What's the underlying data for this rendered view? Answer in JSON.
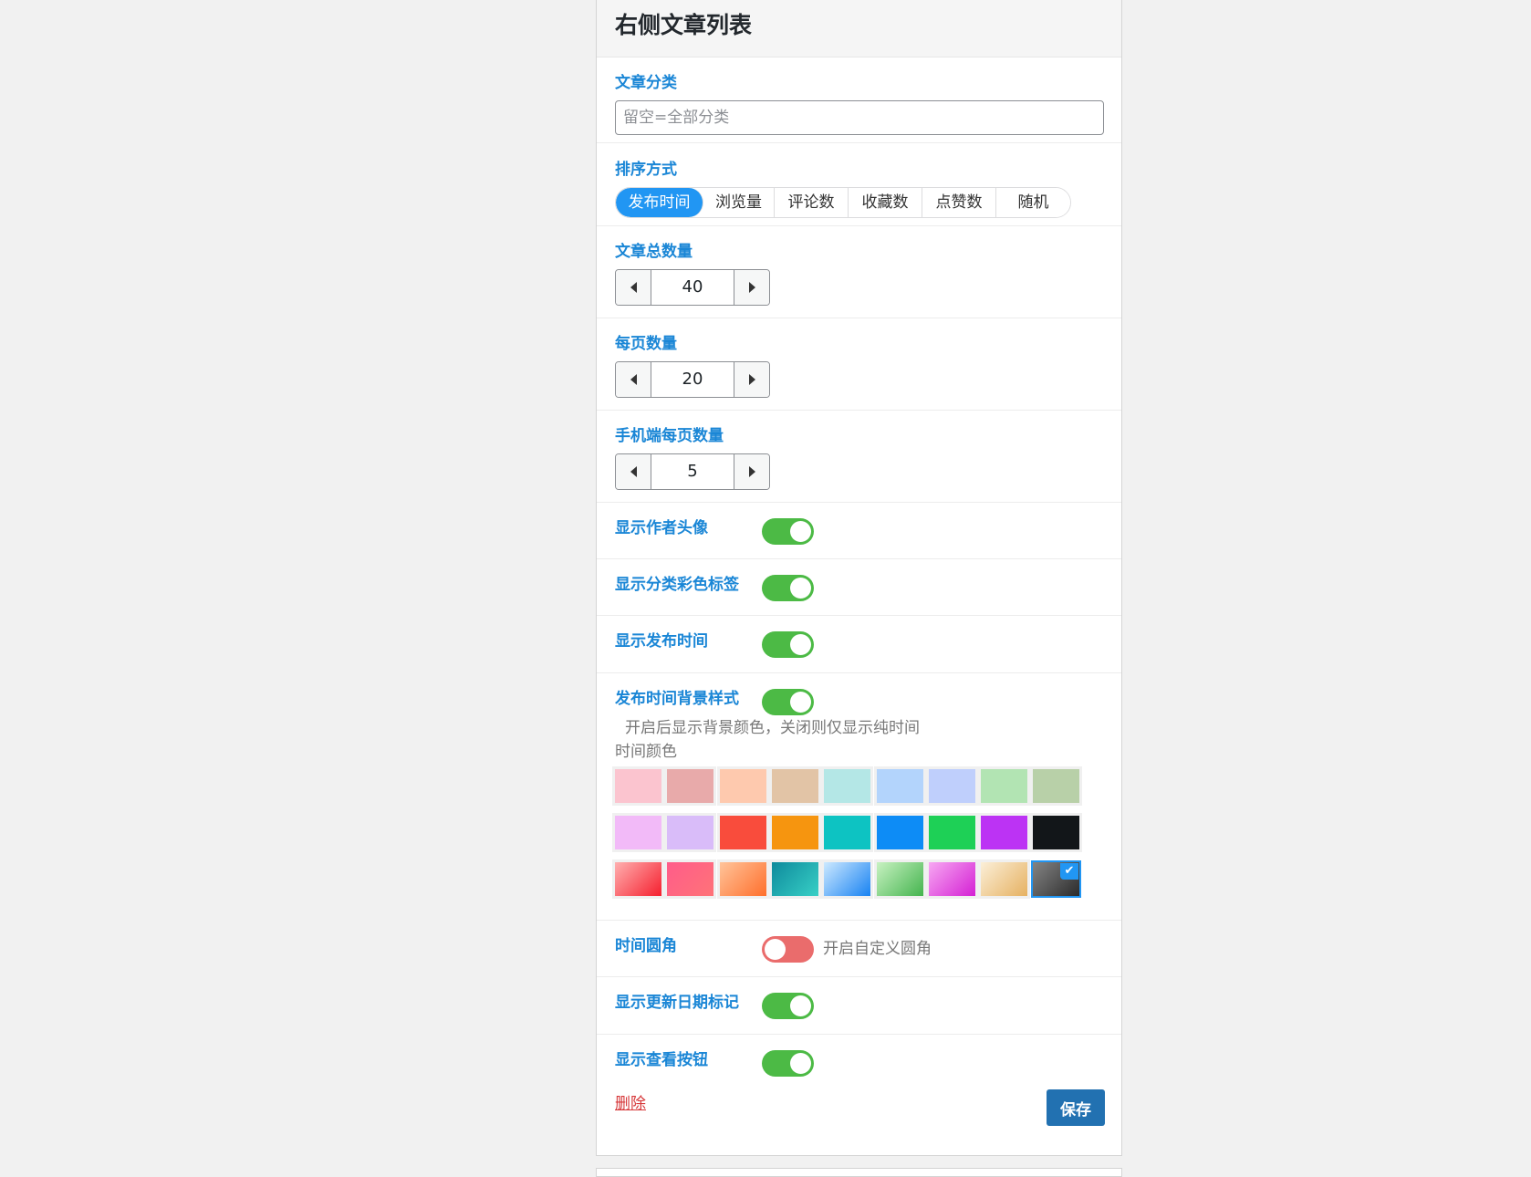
{
  "panel": {
    "title": "右侧文章列表"
  },
  "category": {
    "label": "文章分类",
    "placeholder": "留空=全部分类",
    "value": ""
  },
  "sort": {
    "label": "排序方式",
    "options": [
      "发布时间",
      "浏览量",
      "评论数",
      "收藏数",
      "点赞数",
      "随机"
    ],
    "selected": "发布时间"
  },
  "total_count": {
    "label": "文章总数量",
    "value": "40"
  },
  "per_page": {
    "label": "每页数量",
    "value": "20"
  },
  "mobile_per_page": {
    "label": "手机端每页数量",
    "value": "5"
  },
  "toggles": {
    "show_avatar": {
      "label": "显示作者头像",
      "on": true
    },
    "show_category_tag": {
      "label": "显示分类彩色标签",
      "on": true
    },
    "show_time": {
      "label": "显示发布时间",
      "on": true
    },
    "time_bg_style": {
      "label": "发布时间背景样式",
      "on": true,
      "description": "开启后显示背景颜色，关闭则仅显示纯时间"
    },
    "time_radius": {
      "label": "时间圆角",
      "on": false,
      "hint": "开启自定义圆角"
    },
    "show_update_mark": {
      "label": "显示更新日期标记",
      "on": true
    },
    "show_view_button": {
      "label": "显示查看按钮",
      "on": true
    }
  },
  "time_color": {
    "label": "时间颜色",
    "rows": [
      [
        "#fbc4cf",
        "#e8aaaa",
        "#fec9ae",
        "#e2c4a6",
        "#b4e7e6",
        "#b3d4fc",
        "#bfcffc",
        "#b2e4b3",
        "#b8d0a8"
      ],
      [
        "#f2baf8",
        "#d9bcf9",
        "#f94c3c",
        "#f6950f",
        "#0dc3c2",
        "#0d8cf6",
        "#1ed056",
        "#bc33f4",
        "#121619"
      ],
      [
        "linear-gradient(135deg,#ffb0b0,#f51f2e)",
        "linear-gradient(135deg,#ff5c8a,#ff7378)",
        "linear-gradient(135deg,#ffc49a,#ff6f2c)",
        "linear-gradient(135deg,#0e8a9c,#38d0c6)",
        "linear-gradient(135deg,#cde9ff,#1882f2)",
        "linear-gradient(135deg,#c8f2c2,#44b44e)",
        "linear-gradient(135deg,#f7a8f2,#d420d4)",
        "linear-gradient(135deg,#fbefd8,#e6b161)",
        "linear-gradient(135deg,#848484,#2b2b2b)"
      ]
    ],
    "selected": [
      2,
      8
    ]
  },
  "actions": {
    "delete_label": "删除",
    "save_label": "保存"
  },
  "colors": {
    "accent": "#2196f3",
    "label_blue": "#1a86d6",
    "toggle_on": "#4cba45",
    "toggle_off": "#ea6c6c",
    "save": "#2271b1",
    "delete": "#d63638"
  }
}
